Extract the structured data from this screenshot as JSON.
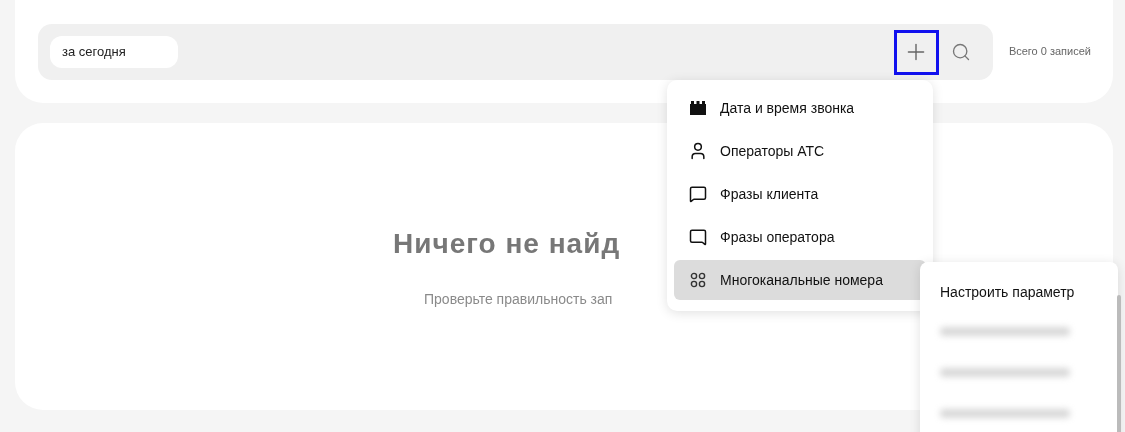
{
  "filter_bar": {
    "chip": "за сегодня",
    "total": "Всего 0 записей"
  },
  "empty_state": {
    "title": "Ничего не найд",
    "subtitle": "Проверьте правильность зап"
  },
  "menu": {
    "items": [
      {
        "label": "Дата и время звонка",
        "selected": false
      },
      {
        "label": "Операторы АТС",
        "selected": false
      },
      {
        "label": "Фразы клиента",
        "selected": false
      },
      {
        "label": "Фразы оператора",
        "selected": false
      },
      {
        "label": "Многоканальные номера",
        "selected": true
      }
    ]
  },
  "submenu": {
    "title": "Настроить параметр"
  }
}
